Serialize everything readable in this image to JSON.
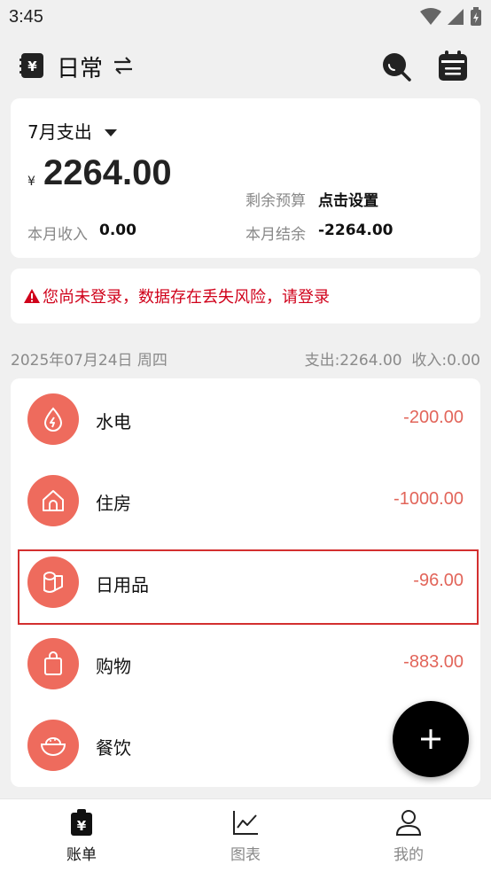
{
  "status": {
    "time": "3:45"
  },
  "header": {
    "book_name": "日常",
    "icons": [
      "ledger-icon",
      "swap-icon",
      "search-icon",
      "calendar-icon"
    ]
  },
  "summary": {
    "month_label": "7月支出",
    "currency_symbol": "¥",
    "expense_total": "2264.00",
    "budget_label": "剩余预算",
    "budget_value": "点击设置",
    "income_label": "本月收入",
    "income_value": "0.00",
    "balance_label": "本月结余",
    "balance_value": "-2264.00"
  },
  "warning": {
    "text": "您尚未登录，数据存在丢失风险，请登录"
  },
  "day": {
    "date": "2025年07月24日 周四",
    "totals": "支出:2264.00  收入:0.00"
  },
  "records": [
    {
      "category": "水电",
      "amount": "-200.00",
      "icon": "water-electric-icon"
    },
    {
      "category": "住房",
      "amount": "-1000.00",
      "icon": "house-icon"
    },
    {
      "category": "日用品",
      "amount": "-96.00",
      "icon": "toilet-paper-icon"
    },
    {
      "category": "购物",
      "amount": "-883.00",
      "icon": "shopping-bag-icon"
    },
    {
      "category": "餐饮",
      "amount": "",
      "icon": "rice-bowl-icon"
    }
  ],
  "fab": {
    "icon": "plus-icon"
  },
  "nav": [
    {
      "label": "账单",
      "icon": "bill-icon",
      "active": true
    },
    {
      "label": "图表",
      "icon": "chart-icon",
      "active": false
    },
    {
      "label": "我的",
      "icon": "person-icon",
      "active": false
    }
  ],
  "colors": {
    "accent": "#ee6b5d",
    "expense_text": "#e2655a",
    "warning": "#d0021b",
    "highlight_border": "#d32f2f"
  }
}
